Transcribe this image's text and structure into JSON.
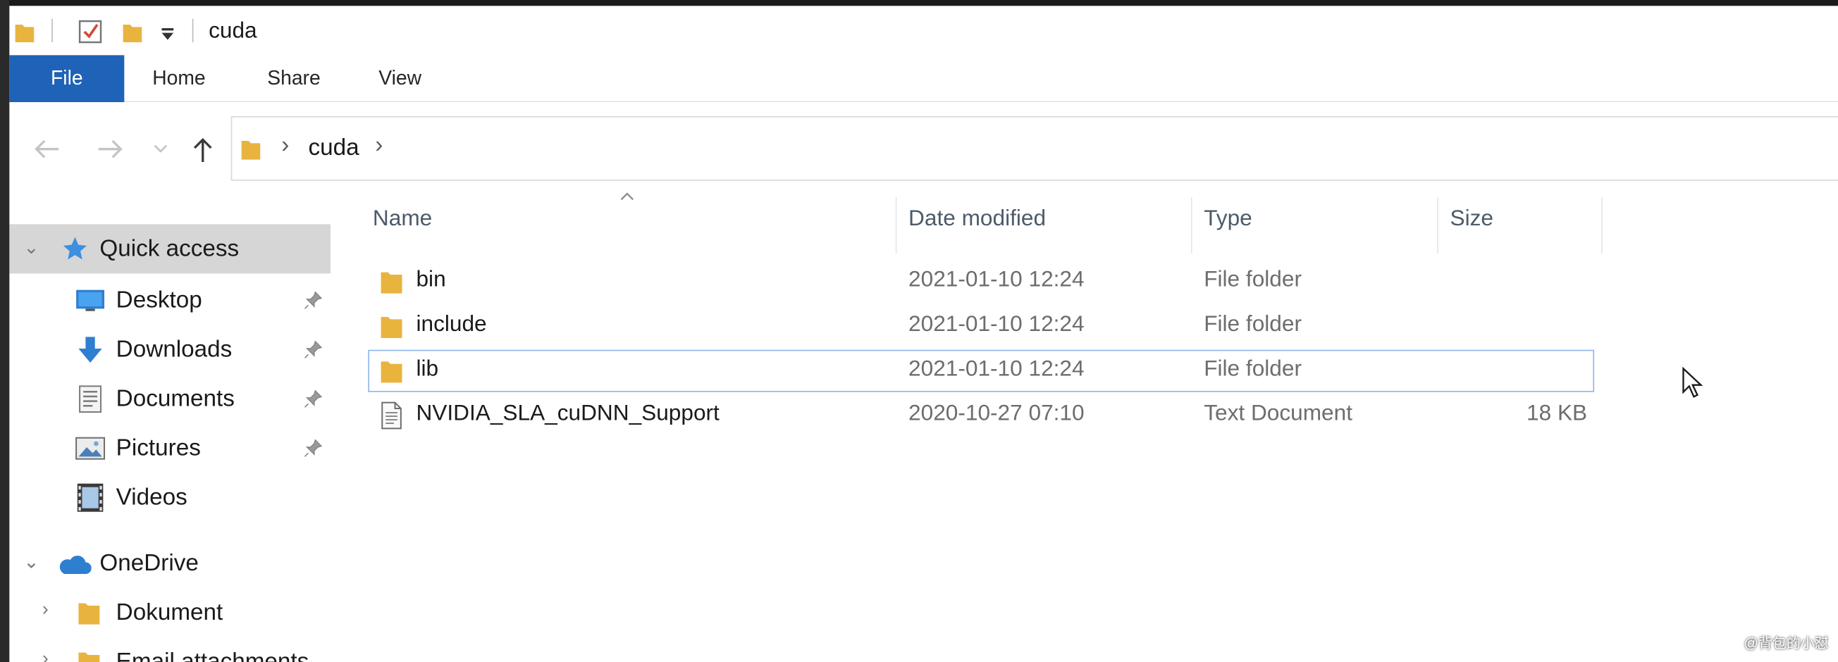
{
  "window": {
    "title": "cuda",
    "quick_access_icons": [
      "folder-icon",
      "properties-checkbox-icon",
      "new-folder-icon",
      "customize-dropdown-icon"
    ]
  },
  "ribbon": {
    "tabs": [
      {
        "label": "File"
      },
      {
        "label": "Home"
      },
      {
        "label": "Share"
      },
      {
        "label": "View"
      }
    ]
  },
  "address": {
    "back_icon": "arrow-left-icon",
    "forward_icon": "arrow-right-icon",
    "recent_icon": "chevron-down-icon",
    "up_icon": "arrow-up-icon",
    "breadcrumb": [
      "cuda"
    ]
  },
  "sidebar": {
    "quick_access": {
      "label": "Quick access",
      "expanded": true
    },
    "items": [
      {
        "label": "Desktop",
        "icon": "desktop-icon",
        "pinned": true
      },
      {
        "label": "Downloads",
        "icon": "download-icon",
        "pinned": true
      },
      {
        "label": "Documents",
        "icon": "documents-icon",
        "pinned": true
      },
      {
        "label": "Pictures",
        "icon": "pictures-icon",
        "pinned": true
      },
      {
        "label": "Videos",
        "icon": "videos-icon",
        "pinned": false
      }
    ],
    "onedrive": {
      "label": "OneDrive",
      "expanded": true
    },
    "onedrive_items": [
      {
        "label": "Dokument"
      },
      {
        "label": "Email attachments"
      }
    ]
  },
  "list": {
    "columns": {
      "name": "Name",
      "date": "Date modified",
      "type": "Type",
      "size": "Size"
    },
    "rows": [
      {
        "name": "bin",
        "date": "2021-01-10 12:24",
        "type": "File folder",
        "size": "",
        "icon": "folder-icon"
      },
      {
        "name": "include",
        "date": "2021-01-10 12:24",
        "type": "File folder",
        "size": "",
        "icon": "folder-icon"
      },
      {
        "name": "lib",
        "date": "2021-01-10 12:24",
        "type": "File folder",
        "size": "",
        "icon": "folder-icon",
        "focused": true
      },
      {
        "name": "NVIDIA_SLA_cuDNN_Support",
        "date": "2020-10-27 07:10",
        "type": "Text Document",
        "size": "18 KB",
        "icon": "text-document-icon"
      }
    ]
  },
  "watermark": "@背包的小怼",
  "colors": {
    "file_tab": "#1f63b8",
    "folder": "#e8b43e",
    "selection_outline": "#8fb7e6",
    "selected_nav": "#d6d6d6"
  }
}
